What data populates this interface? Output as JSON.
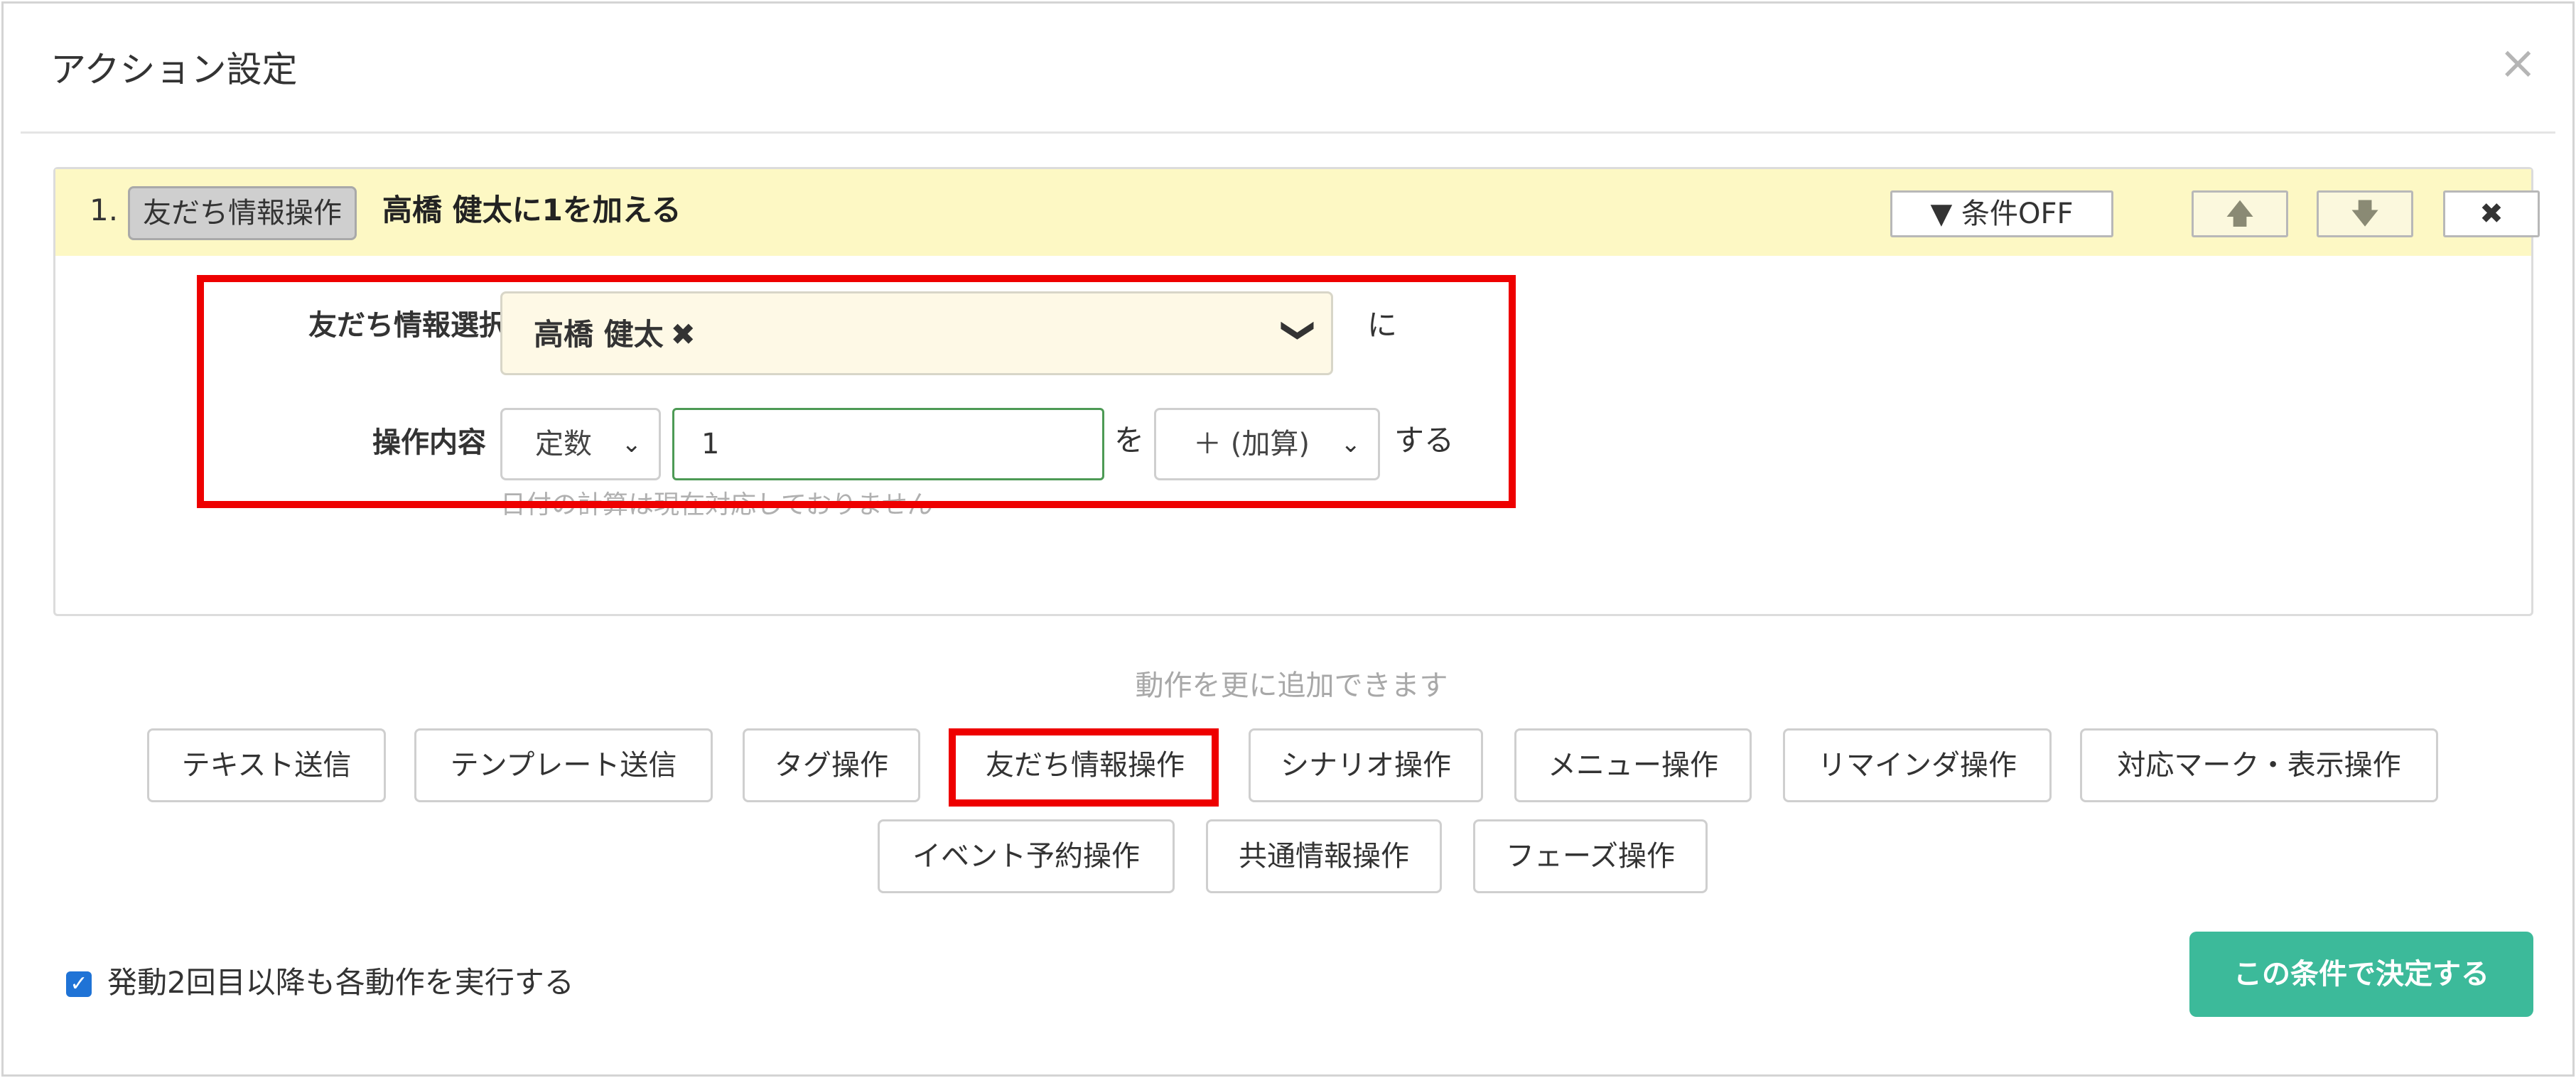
{
  "modal": {
    "title": "アクション設定",
    "close_glyph": "×"
  },
  "action": {
    "number": "1.",
    "type_label": "友だち情報操作",
    "summary": "高橋 健太に1を加える",
    "header_buttons": {
      "condition": "条件OFF",
      "condition_icon": "▼",
      "up": "🡅",
      "down": "🡇",
      "delete": "✖"
    },
    "friend_field": {
      "label": "友だち情報選択",
      "selected": "高橋 健太",
      "remove_glyph": "✖",
      "chevron": "❯",
      "particle": "に"
    },
    "operation": {
      "label": "操作内容",
      "mode": "定数",
      "value": "1",
      "particle_wo": "を",
      "operator": "＋ (加算)",
      "suffix": "する",
      "hint": "日付の計算は現在対応しておりません"
    }
  },
  "add_section": {
    "hint": "動作を更に追加できます",
    "row1": [
      "テキスト送信",
      "テンプレート送信",
      "タグ操作",
      "友だち情報操作",
      "シナリオ操作",
      "メニュー操作",
      "リマインダ操作",
      "対応マーク・表示操作"
    ],
    "row2": [
      "イベント予約操作",
      "共通情報操作",
      "フェーズ操作"
    ]
  },
  "footer": {
    "checkbox_label": "発動2回目以降も各動作を実行する",
    "checked": true,
    "submit_label": "この条件で決定する"
  },
  "colors": {
    "header_bg": "#fdf8c4",
    "highlight": "#ee0000",
    "submit_bg": "#3cba9a",
    "checkbox": "#1f73d6",
    "input_border": "#4d9a55"
  }
}
